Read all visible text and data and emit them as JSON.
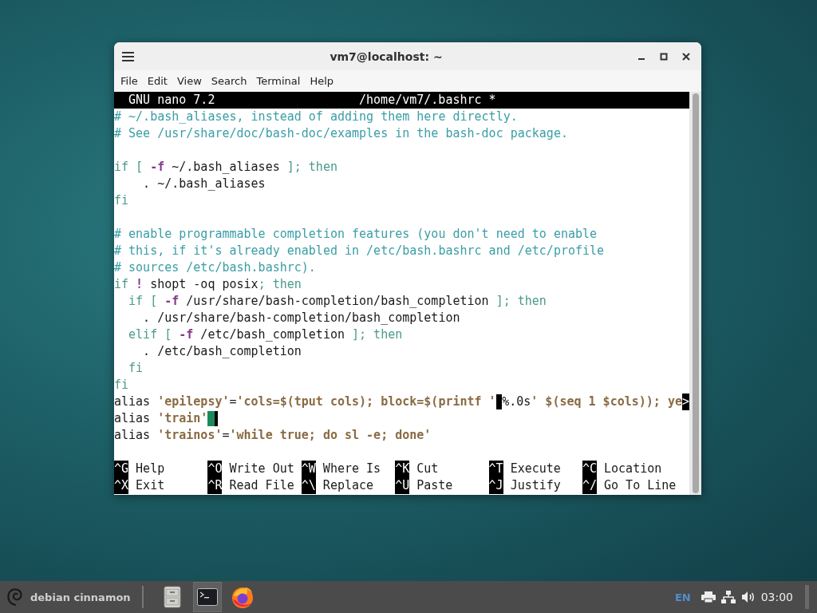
{
  "window": {
    "title": "vm7@localhost: ~",
    "menu": [
      "File",
      "Edit",
      "View",
      "Search",
      "Terminal",
      "Help"
    ]
  },
  "editor": {
    "header_left": "GNU nano 7.2",
    "header_file": "/home/vm7/.bashrc *",
    "lines": [
      {
        "kind": "code",
        "segments": [
          {
            "t": "# ~/.bash_aliases, instead of adding them here directly.",
            "kind": "comment"
          }
        ]
      },
      {
        "kind": "code",
        "segments": [
          {
            "t": "# See /usr/share/doc/bash-doc/examples in the bash-doc package.",
            "kind": "comment"
          }
        ]
      },
      {
        "kind": "blank"
      },
      {
        "kind": "code",
        "segments": [
          {
            "t": "if [ ",
            "kind": "keyword"
          },
          {
            "t": "-f",
            "kind": "flag"
          },
          {
            "t": " ~/.bash_aliases ",
            "kind": "plain"
          },
          {
            "t": "]; then",
            "kind": "keyword"
          }
        ]
      },
      {
        "kind": "code",
        "segments": [
          {
            "t": "    . ~/.bash_aliases",
            "kind": "plain"
          }
        ]
      },
      {
        "kind": "code",
        "segments": [
          {
            "t": "fi",
            "kind": "keyword"
          }
        ]
      },
      {
        "kind": "blank"
      },
      {
        "kind": "code",
        "segments": [
          {
            "t": "# enable programmable completion features (you don't need to enable",
            "kind": "comment"
          }
        ]
      },
      {
        "kind": "code",
        "segments": [
          {
            "t": "# this, if it's already enabled in /etc/bash.bashrc and /etc/profile",
            "kind": "comment"
          }
        ]
      },
      {
        "kind": "code",
        "segments": [
          {
            "t": "# sources /etc/bash.bashrc).",
            "kind": "comment"
          }
        ]
      },
      {
        "kind": "code",
        "segments": [
          {
            "t": "if ",
            "kind": "keyword"
          },
          {
            "t": "!",
            "kind": "flag"
          },
          {
            "t": " shopt -oq posix",
            "kind": "plain"
          },
          {
            "t": "; then",
            "kind": "keyword"
          }
        ]
      },
      {
        "kind": "code",
        "segments": [
          {
            "t": "  if [ ",
            "kind": "keyword"
          },
          {
            "t": "-f",
            "kind": "flag"
          },
          {
            "t": " /usr/share/bash-completion/bash_completion ",
            "kind": "plain"
          },
          {
            "t": "]; then",
            "kind": "keyword"
          }
        ]
      },
      {
        "kind": "code",
        "segments": [
          {
            "t": "    . /usr/share/bash-completion/bash_completion",
            "kind": "plain"
          }
        ]
      },
      {
        "kind": "code",
        "segments": [
          {
            "t": "  elif [ ",
            "kind": "keyword"
          },
          {
            "t": "-f",
            "kind": "flag"
          },
          {
            "t": " /etc/bash_completion ",
            "kind": "plain"
          },
          {
            "t": "]; then",
            "kind": "keyword"
          }
        ]
      },
      {
        "kind": "code",
        "segments": [
          {
            "t": "    . /etc/bash_completion",
            "kind": "plain"
          }
        ]
      },
      {
        "kind": "code",
        "segments": [
          {
            "t": "  fi",
            "kind": "keyword"
          }
        ]
      },
      {
        "kind": "code",
        "segments": [
          {
            "t": "fi",
            "kind": "keyword"
          }
        ]
      },
      {
        "kind": "code",
        "segments": [
          {
            "t": "alias ",
            "kind": "plain"
          },
          {
            "t": "'epilepsy'",
            "kind": "string"
          },
          {
            "t": "=",
            "kind": "plain"
          },
          {
            "t": "'cols=$(tput cols); block=$(printf '",
            "kind": "string"
          },
          {
            "kind": "block"
          },
          {
            "t": "%.0s",
            "kind": "plain"
          },
          {
            "t": "' $(seq 1 $cols)); ye",
            "kind": "string"
          },
          {
            "t": ">",
            "kind": "overflow"
          }
        ]
      },
      {
        "kind": "code",
        "segments": [
          {
            "t": "alias ",
            "kind": "plain"
          },
          {
            "t": "'train'",
            "kind": "string"
          },
          {
            "kind": "cursor"
          }
        ]
      },
      {
        "kind": "code",
        "segments": [
          {
            "t": "alias ",
            "kind": "plain"
          },
          {
            "t": "'trainos'",
            "kind": "string"
          },
          {
            "t": "=",
            "kind": "plain"
          },
          {
            "t": "'while true; do sl -e; done'",
            "kind": "string"
          }
        ]
      },
      {
        "kind": "blank"
      }
    ],
    "shortcuts": [
      [
        {
          "key": "^G",
          "label": "Help"
        },
        {
          "key": "^O",
          "label": "Write Out"
        },
        {
          "key": "^W",
          "label": "Where Is"
        },
        {
          "key": "^K",
          "label": "Cut"
        },
        {
          "key": "^T",
          "label": "Execute"
        },
        {
          "key": "^C",
          "label": "Location"
        }
      ],
      [
        {
          "key": "^X",
          "label": "Exit"
        },
        {
          "key": "^R",
          "label": "Read File"
        },
        {
          "key": "^\\",
          "label": "Replace"
        },
        {
          "key": "^U",
          "label": "Paste"
        },
        {
          "key": "^J",
          "label": "Justify"
        },
        {
          "key": "^/",
          "label": "Go To Line"
        }
      ]
    ]
  },
  "taskbar": {
    "menu_label": "debian cinnamon",
    "launchers": [
      {
        "kind": "files",
        "selected": false
      },
      {
        "kind": "terminal",
        "selected": true
      },
      {
        "kind": "browser",
        "selected": false
      }
    ],
    "keyboard": "EN",
    "clock": "03:00"
  }
}
